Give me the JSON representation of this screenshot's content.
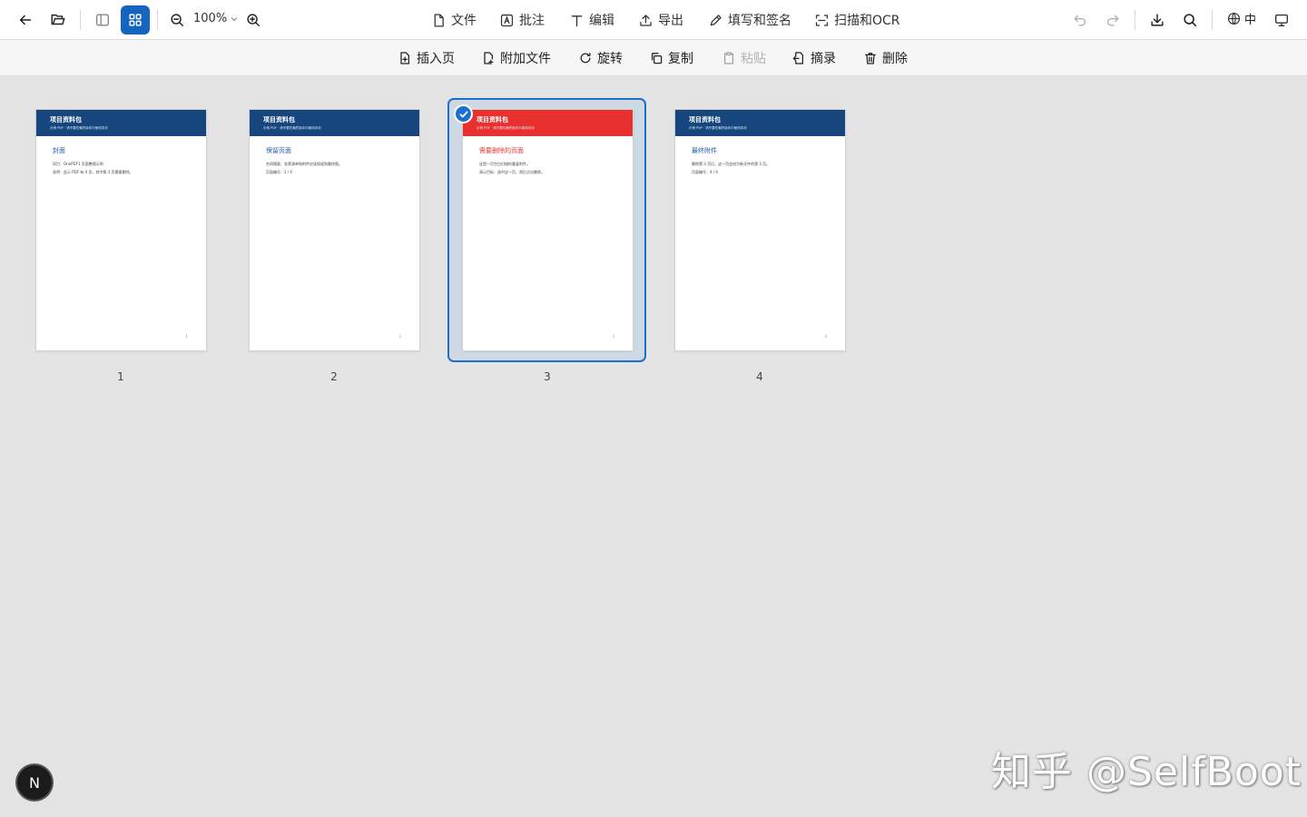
{
  "topbar": {
    "zoom": "100%",
    "menus": {
      "file": "文件",
      "annotate": "批注",
      "edit": "编辑",
      "export": "导出",
      "fill_sign": "填写和签名",
      "scan_ocr": "扫描和OCR"
    },
    "language": "中"
  },
  "toolbar": {
    "insert_page": "插入页",
    "attach_file": "附加文件",
    "rotate": "旋转",
    "copy": "复制",
    "paste": "粘贴",
    "extract": "摘录",
    "delete": "删除"
  },
  "pages": [
    {
      "number": "1",
      "header_title": "项目资料包",
      "header_sub": "示例 PDF · 请不要在最终版本中使用本页",
      "title": "封面",
      "lines": [
        "项目：OnePDF1 页面整理示例",
        "说明：此示 PDF 有 4 页，其中第 3 页需要删除。"
      ],
      "footer": "1",
      "selected": false
    },
    {
      "number": "2",
      "header_title": "项目资料包",
      "header_sub": "示例 PDF · 请不要在最终版本中使用本页",
      "title": "保留页面",
      "lines": [
        "合同摘要、发票清单和附件应该保留到最终版。",
        "页面编号：2 / 4"
      ],
      "footer": "2",
      "selected": false
    },
    {
      "number": "3",
      "header_title": "项目资料包",
      "header_sub": "示例 PDF · 请不要在最终版本中使用本页",
      "title": "需要删除的页面",
      "lines": [
        "这是一页空白扫描的重复附件。",
        "演示目标：选中这一页，然后点击删除。"
      ],
      "footer": "3",
      "selected": true
    },
    {
      "number": "4",
      "header_title": "项目资料包",
      "header_sub": "示例 PDF · 请不要在最终版本中使用本页",
      "title": "最终附件",
      "lines": [
        "删除第 3 页后，这一页会成为新文件的第 3 页。",
        "页面编号：4 / 4"
      ],
      "footer": "4",
      "selected": false
    }
  ],
  "badge": "N",
  "watermark": "知乎 @SelfBoot",
  "colors": {
    "accent": "#1c6fd1",
    "header_blue": "#17467f",
    "header_red": "#e8302e"
  }
}
